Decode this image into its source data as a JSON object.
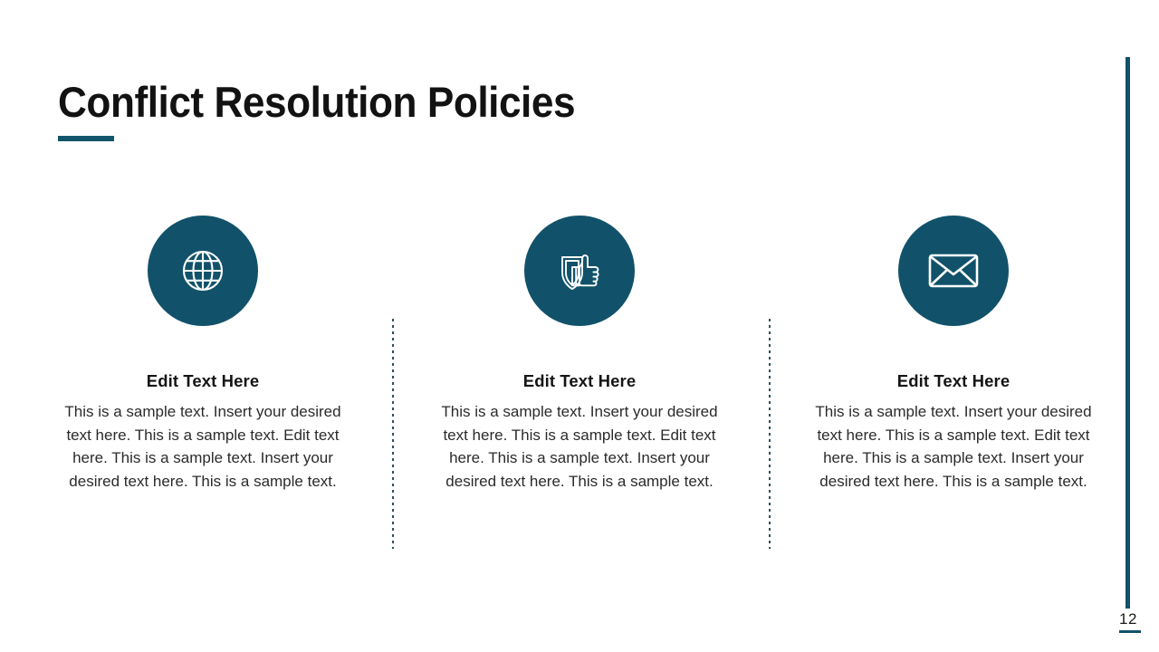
{
  "slide": {
    "title": "Conflict Resolution Policies",
    "page_number": "12",
    "accent_color": "#11526a",
    "title_color": "#121212",
    "background_color": "#ffffff"
  },
  "columns": [
    {
      "icon": "globe-icon",
      "heading": "Edit Text Here",
      "body": "This is a sample text. Insert your desired text here. This is a sample text. Edit text here. This is a sample text. Insert your desired text here. This is a sample text."
    },
    {
      "icon": "shield-thumbs-up-icon",
      "heading": "Edit Text Here",
      "body": "This is a sample text. Insert your desired text here. This is a sample text. Edit text here. This is a sample text. Insert your desired text here. This is a sample text."
    },
    {
      "icon": "envelope-icon",
      "heading": "Edit Text Here",
      "body": "This is a sample text. Insert your desired text here. This is a sample text. Edit text here. This is a sample text. Insert your desired text here. This is a sample text."
    }
  ]
}
